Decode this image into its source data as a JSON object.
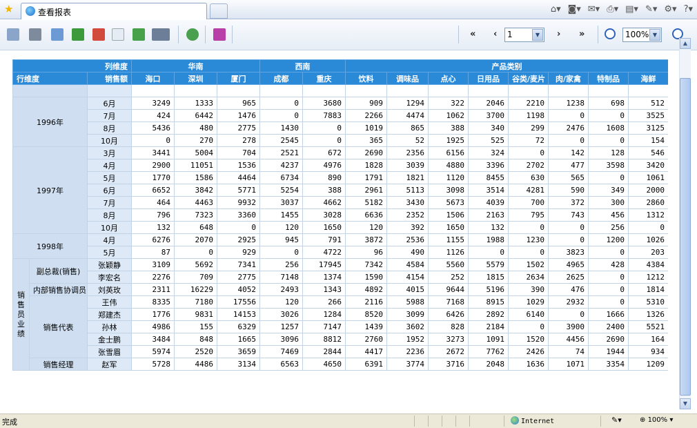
{
  "browser": {
    "tab_title": "查看报表",
    "zone": "Internet",
    "status": "完成",
    "zoom": "100%",
    "toolbar_icons": [
      "home-icon",
      "feeds-icon",
      "mail-icon",
      "print-icon",
      "page-icon",
      "safety-icon",
      "tools-icon",
      "help-icon"
    ]
  },
  "toolbar": {
    "first_label": "«",
    "prev_label": "‹",
    "next_label": "›",
    "last_label": "»",
    "page_value": "1",
    "zoom_value": "100%"
  },
  "report": {
    "corner_col_label": "列维度",
    "corner_row_label": "行维度",
    "corner_measure_label": "销售额",
    "group_headers": [
      {
        "label": "华南",
        "span": 3
      },
      {
        "label": "西南",
        "span": 2
      },
      {
        "label": "产品类别",
        "span": 8
      }
    ],
    "col_headers": [
      "海口",
      "深圳",
      "厦门",
      "成都",
      "重庆",
      "饮料",
      "调味品",
      "点心",
      "日用品",
      "谷类/麦片",
      "肉/家禽",
      "特制品",
      "海鲜"
    ],
    "cut_row": {
      "label": "",
      "values": [
        "...",
        "...",
        "...",
        "...",
        "...",
        "...",
        "...",
        "...",
        "...",
        "...",
        "...",
        "...",
        "..."
      ]
    },
    "year_groups": [
      {
        "label": "1996年",
        "rows": [
          {
            "label": "6月",
            "values": [
              3249,
              1333,
              965,
              0,
              3680,
              909,
              1294,
              322,
              2046,
              2210,
              1238,
              698,
              512
            ]
          },
          {
            "label": "7月",
            "values": [
              424,
              6442,
              1476,
              0,
              7883,
              2266,
              4474,
              1062,
              3700,
              1198,
              0,
              0,
              3525
            ]
          },
          {
            "label": "8月",
            "values": [
              5436,
              480,
              2775,
              1430,
              0,
              1019,
              865,
              388,
              340,
              299,
              2476,
              1608,
              3125
            ]
          },
          {
            "label": "10月",
            "values": [
              0,
              270,
              278,
              2545,
              0,
              365,
              52,
              1925,
              525,
              72,
              0,
              0,
              154
            ]
          }
        ]
      },
      {
        "label": "1997年",
        "rows": [
          {
            "label": "3月",
            "values": [
              3441,
              5004,
              704,
              2521,
              672,
              2690,
              2356,
              6156,
              324,
              0,
              142,
              128,
              546
            ]
          },
          {
            "label": "4月",
            "values": [
              2900,
              11051,
              1536,
              4237,
              4976,
              1828,
              3039,
              4880,
              3396,
              2702,
              477,
              3598,
              3420
            ]
          },
          {
            "label": "5月",
            "values": [
              1770,
              1586,
              4464,
              6734,
              890,
              1791,
              1821,
              1120,
              8455,
              630,
              565,
              0,
              1061
            ]
          },
          {
            "label": "6月",
            "values": [
              6652,
              3842,
              5771,
              5254,
              388,
              2961,
              5113,
              3098,
              3514,
              4281,
              590,
              349,
              2000
            ]
          },
          {
            "label": "7月",
            "values": [
              464,
              4463,
              9932,
              3037,
              4662,
              5182,
              3430,
              5673,
              4039,
              700,
              372,
              300,
              2860
            ]
          },
          {
            "label": "8月",
            "values": [
              796,
              7323,
              3360,
              1455,
              3028,
              6636,
              2352,
              1506,
              2163,
              795,
              743,
              456,
              1312
            ]
          },
          {
            "label": "10月",
            "values": [
              132,
              648,
              0,
              120,
              1650,
              120,
              392,
              1650,
              132,
              0,
              0,
              256,
              0
            ]
          }
        ]
      },
      {
        "label": "1998年",
        "rows": [
          {
            "label": "4月",
            "values": [
              6276,
              2070,
              2925,
              945,
              791,
              3872,
              2536,
              1155,
              1988,
              1230,
              0,
              1200,
              1026
            ]
          },
          {
            "label": "5月",
            "values": [
              87,
              0,
              929,
              0,
              4722,
              96,
              490,
              1126,
              0,
              0,
              3823,
              0,
              203
            ]
          }
        ]
      }
    ],
    "sales_group_label": "销售员业绩",
    "title_groups": [
      {
        "title": "副总裁(销售)",
        "rows": [
          {
            "label": "张颖静",
            "values": [
              3109,
              5692,
              7341,
              256,
              17945,
              7342,
              4584,
              5560,
              5579,
              1502,
              4965,
              428,
              4384
            ]
          },
          {
            "label": "李宏名",
            "values": [
              2276,
              709,
              2775,
              7148,
              1374,
              1590,
              4154,
              252,
              1815,
              2634,
              2625,
              0,
              1212
            ]
          }
        ]
      },
      {
        "title": "内部销售协调员",
        "rows": [
          {
            "label": "刘英玫",
            "values": [
              2311,
              16229,
              4052,
              2493,
              1343,
              4892,
              4015,
              9644,
              5196,
              390,
              476,
              0,
              1814
            ]
          }
        ]
      },
      {
        "title": "销售代表",
        "rows": [
          {
            "label": "王伟",
            "values": [
              8335,
              7180,
              17556,
              120,
              266,
              2116,
              5988,
              7168,
              8915,
              1029,
              2932,
              0,
              5310
            ]
          },
          {
            "label": "郑建杰",
            "values": [
              1776,
              9831,
              14153,
              3026,
              1284,
              8520,
              3099,
              6426,
              2892,
              6140,
              0,
              1666,
              1326
            ]
          },
          {
            "label": "孙林",
            "values": [
              4986,
              155,
              6329,
              1257,
              7147,
              1439,
              3602,
              828,
              2184,
              0,
              3900,
              2400,
              5521
            ]
          },
          {
            "label": "金士鹏",
            "values": [
              3484,
              848,
              1665,
              3096,
              8812,
              2760,
              1952,
              3273,
              1091,
              1520,
              4456,
              2690,
              164
            ]
          },
          {
            "label": "张雪眉",
            "values": [
              5974,
              2520,
              3659,
              7469,
              2844,
              4417,
              2236,
              2672,
              7762,
              2426,
              74,
              1944,
              934
            ]
          }
        ]
      },
      {
        "title": "销售经理",
        "rows": [
          {
            "label": "赵军",
            "values": [
              5728,
              4486,
              3134,
              6563,
              4650,
              6391,
              3774,
              3716,
              2048,
              1636,
              1071,
              3354,
              1209
            ]
          }
        ]
      }
    ]
  }
}
